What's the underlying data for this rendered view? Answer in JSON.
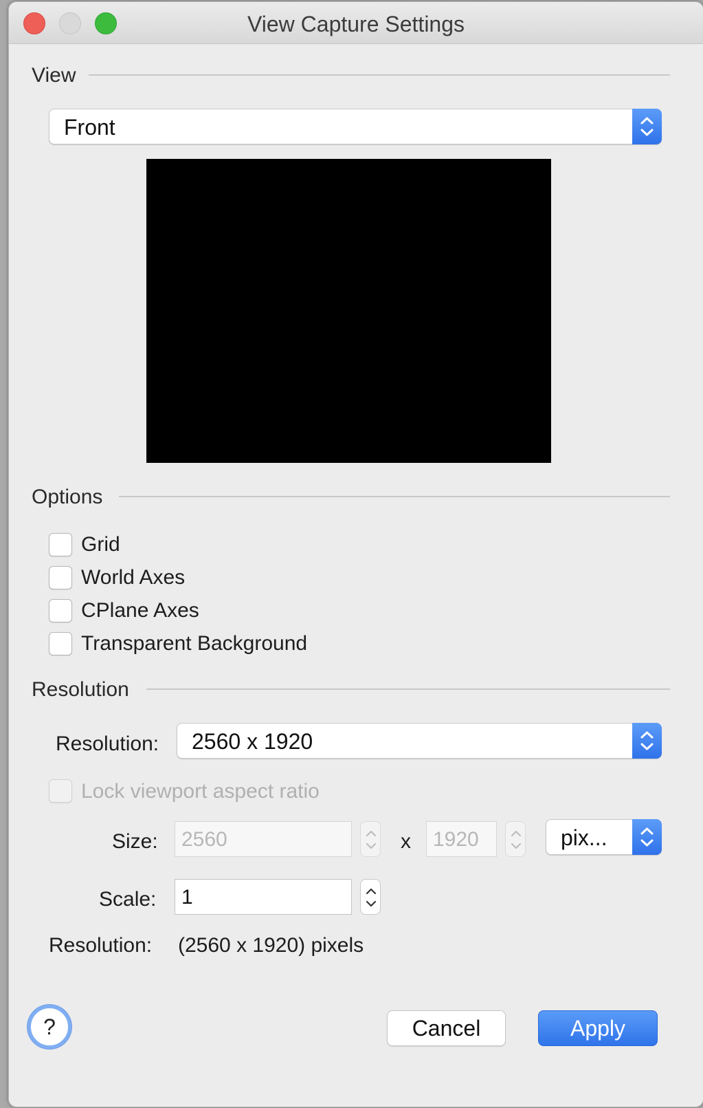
{
  "window": {
    "title": "View Capture Settings"
  },
  "view_section": {
    "heading": "View",
    "view_select": {
      "value": "Front"
    }
  },
  "options_section": {
    "heading": "Options",
    "checkboxes": [
      {
        "label": "Grid",
        "checked": false
      },
      {
        "label": "World Axes",
        "checked": false
      },
      {
        "label": "CPlane Axes",
        "checked": false
      },
      {
        "label": "Transparent Background",
        "checked": false
      }
    ]
  },
  "resolution_section": {
    "heading": "Resolution",
    "resolution_label": "Resolution:",
    "resolution_select": {
      "value": "2560 x 1920"
    },
    "lock_aspect": {
      "label": "Lock viewport aspect ratio",
      "checked": false,
      "enabled": false
    },
    "size_label": "Size:",
    "width_value": "2560",
    "times": "x",
    "height_value": "1920",
    "unit_select": {
      "value": "pix..."
    },
    "scale_label": "Scale:",
    "scale_value": "1",
    "result_label": "Resolution:",
    "result_value": "(2560 x 1920) pixels"
  },
  "footer": {
    "help": "?",
    "cancel": "Cancel",
    "apply": "Apply"
  },
  "colors": {
    "accent": "#3478f6",
    "window_bg": "#ececec",
    "close": "#ee5f57",
    "zoom": "#3cbb3d"
  }
}
